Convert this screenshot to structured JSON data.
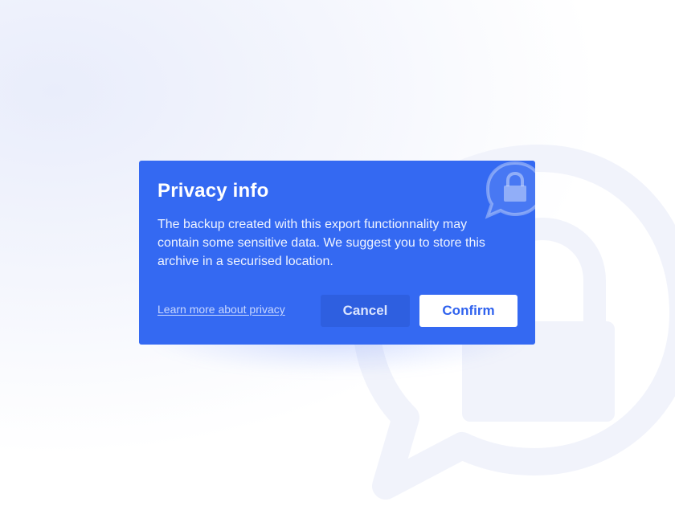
{
  "dialog": {
    "title": "Privacy info",
    "message": "The backup created with this export functionnality may contain some sensitive data. We suggest you to store this archive in a securised location.",
    "learn_more_link": "Learn more about privacy",
    "cancel_label": "Cancel",
    "confirm_label": "Confirm",
    "icon": "lock-speech-bubble-icon"
  },
  "background": {
    "watermark_icon": "lock-speech-bubble-icon"
  },
  "colors": {
    "dialog_background": "#3469f2",
    "confirm_button_background": "#ffffff",
    "confirm_button_text": "#2f62ee",
    "cancel_button_background": "#2e5fe0",
    "link_text": "#c9d8ff"
  }
}
